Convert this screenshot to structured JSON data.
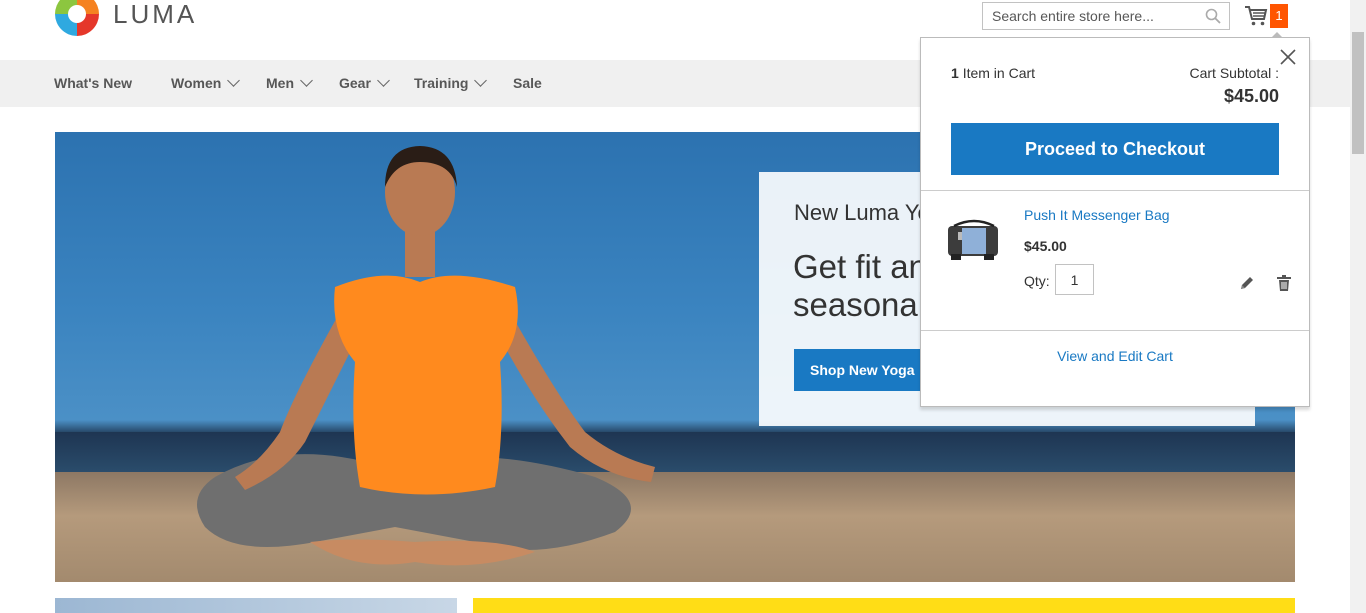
{
  "brand": {
    "name": "LUMA"
  },
  "search": {
    "placeholder": "Search entire store here...",
    "value": ""
  },
  "cart": {
    "count": "1"
  },
  "nav": {
    "items": [
      {
        "label": "What's New",
        "has_dropdown": false
      },
      {
        "label": "Women",
        "has_dropdown": true
      },
      {
        "label": "Men",
        "has_dropdown": true
      },
      {
        "label": "Gear",
        "has_dropdown": true
      },
      {
        "label": "Training",
        "has_dropdown": true
      },
      {
        "label": "Sale",
        "has_dropdown": false
      }
    ]
  },
  "hero": {
    "subtitle": "New Luma Yo",
    "headline_line1": "Get fit an",
    "headline_line2": "seasonal",
    "button_label": "Shop New Yoga"
  },
  "minicart": {
    "item_count": "1",
    "item_count_suffix": "Item in Cart",
    "subtotal_label": "Cart Subtotal :",
    "subtotal_value": "$45.00",
    "checkout_label": "Proceed to Checkout",
    "item": {
      "name": "Push It Messenger Bag",
      "price": "$45.00",
      "qty_label": "Qty:",
      "qty": "1"
    },
    "view_cart_label": "View and Edit Cart"
  },
  "icons": {
    "search": "search-icon",
    "cart": "cart-icon",
    "close": "close-icon",
    "edit": "pencil-icon",
    "delete": "trash-icon"
  },
  "colors": {
    "primary": "#1979c3",
    "counter": "#ff5501",
    "nav_bg": "#f0f0f0",
    "tile_yellow": "#ffdd16"
  }
}
